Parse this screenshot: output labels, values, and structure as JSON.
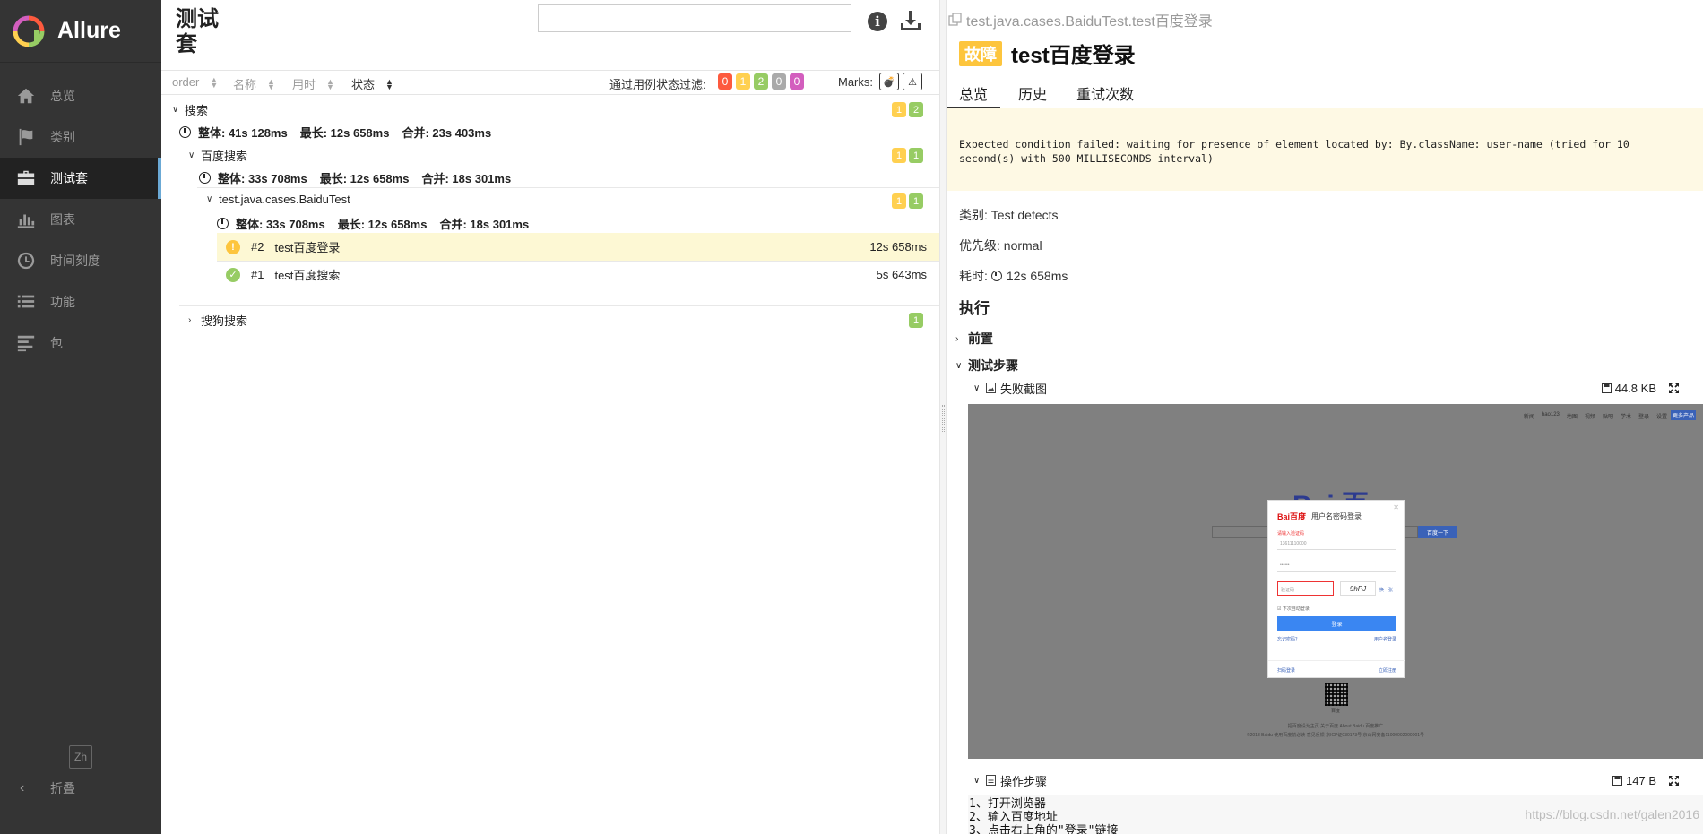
{
  "sidebar": {
    "brand": "Allure",
    "items": [
      {
        "label": "总览",
        "icon": "home-icon"
      },
      {
        "label": "类别",
        "icon": "flag-icon"
      },
      {
        "label": "测试套",
        "icon": "briefcase-icon"
      },
      {
        "label": "图表",
        "icon": "bar-chart-icon"
      },
      {
        "label": "时间刻度",
        "icon": "clock-icon"
      },
      {
        "label": "功能",
        "icon": "list-icon"
      },
      {
        "label": "包",
        "icon": "align-left-icon"
      }
    ],
    "active_item": "测试套",
    "lang": "Zh",
    "collapse_label": "折叠"
  },
  "suites": {
    "title": "测试套",
    "search": {
      "value": "",
      "placeholder": ""
    },
    "sort_columns": [
      "order",
      "名称",
      "用时",
      "状态"
    ],
    "active_sort": "状态",
    "filter_label": "通过用例状态过滤:",
    "filter_badges": [
      {
        "count": "0",
        "color": "#fd5a3e",
        "status": "failed"
      },
      {
        "count": "1",
        "color": "#ffd050",
        "status": "broken"
      },
      {
        "count": "2",
        "color": "#97cc64",
        "status": "passed"
      },
      {
        "count": "0",
        "color": "#aaaaaa",
        "status": "skipped"
      },
      {
        "count": "0",
        "color": "#d35ebe",
        "status": "unknown"
      }
    ],
    "marks_label": "Marks:",
    "tree": {
      "group1": {
        "name": "搜索",
        "badges": [
          "1",
          "2"
        ],
        "stats": {
          "total": "整体: 41s 128ms",
          "max": "最长: 12s 658ms",
          "merged": "合并: 23s 403ms"
        }
      },
      "group2": {
        "name": "百度搜索",
        "badges": [
          "1",
          "1"
        ],
        "stats": {
          "total": "整体: 33s 708ms",
          "max": "最长: 12s 658ms",
          "merged": "合并: 18s 301ms"
        }
      },
      "group3": {
        "name": "test.java.cases.BaiduTest",
        "badges": [
          "1",
          "1"
        ],
        "stats": {
          "total": "整体: 33s 708ms",
          "max": "最长: 12s 658ms",
          "merged": "合并: 18s 301ms"
        }
      },
      "cases": [
        {
          "num": "#2",
          "name": "test百度登录",
          "duration": "12s 658ms",
          "status": "broken"
        },
        {
          "num": "#1",
          "name": "test百度搜索",
          "duration": "5s 643ms",
          "status": "passed"
        }
      ],
      "group4": {
        "name": "搜狗搜索",
        "badges": [
          "1"
        ]
      }
    }
  },
  "detail": {
    "path": "test.java.cases.BaiduTest.test百度登录",
    "status_label": "故障",
    "title": "test百度登录",
    "tabs": [
      "总览",
      "历史",
      "重试次数"
    ],
    "active_tab": "总览",
    "error_message": "Expected condition failed: waiting for presence of element located by: By.className: user-name (tried for 10 second(s) with 500 MILLISECONDS interval)",
    "category": "类别: Test defects",
    "severity": "优先级: normal",
    "duration_label": "耗时:",
    "duration_value": "12s 658ms",
    "execution_heading": "执行",
    "setup_label": "前置",
    "steps_label": "测试步骤",
    "attachments": [
      {
        "name": "失败截图",
        "size": "44.8 KB",
        "icon": "image-file-icon"
      },
      {
        "name": "操作步骤",
        "size": "147 B",
        "icon": "text-file-icon"
      }
    ],
    "steps_text": "1、打开浏览器\n2、输入百度地址\n3、点击右上角的\"登录\"链接",
    "watermark": "https://blog.csdn.net/galen2016"
  },
  "screenshot": {
    "nav_links": [
      "新闻",
      "hao123",
      "地图",
      "视频",
      "贴吧",
      "学术",
      "登录",
      "设置"
    ],
    "nav_button": "更多产品",
    "logo": "Bai 百度",
    "search_button": "百度一下",
    "modal_brand": "Bai百度",
    "modal_title": "用户名密码登录",
    "error_text": "请输入验证码",
    "username_value": "13611110000",
    "password_value": "••••••",
    "captcha_placeholder": "验证码",
    "captcha_text": "9hPJ",
    "captcha_refresh": "换一张",
    "remember": "☑ 下次自动登录",
    "login_button": "登录",
    "link_left": "忘记密码？",
    "link_right": "用户名登录",
    "foot_left": "扫码登录",
    "foot_right": "立即注册",
    "qr_caption": "百度",
    "footer1": "把百度设为主页   关于百度   About Baidu   百度推广",
    "footer2": "©2018 Baidu 使用百度前必读 意见反馈 京ICP证030173号   京公网安备11000002000001号"
  }
}
